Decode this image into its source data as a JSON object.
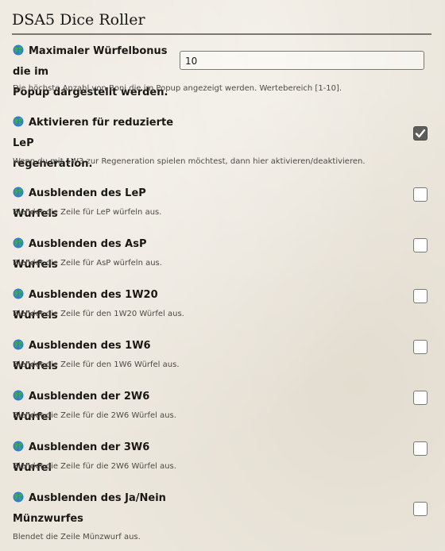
{
  "header": {
    "title": "DSA5 Dice Roller"
  },
  "icons": {
    "setting": "globe-icon"
  },
  "colors": {
    "checkbox_checked": "#5d5d5a",
    "divider": "#7a7971"
  },
  "settings": [
    {
      "label_line1": "Maximaler Würfelbonus die im",
      "label_line2": "Popup dargestellt werden.",
      "hint": "Die höchste Anzahl von Boni die im Popup angezeigt werden. Wertebereich [1-10].",
      "type": "number",
      "value": "10"
    },
    {
      "label_line1": "Aktivieren für reduzierte LeP",
      "label_line2": "regeneration.",
      "hint": "Wenn du mit 1W3 zur Regeneration spielen möchtest, dann hier aktivieren/deaktivieren.",
      "type": "checkbox",
      "checked": true
    },
    {
      "label_line1": "Ausblenden des LeP Würfels",
      "hint": "Blendet die Zeile für LeP würfeln aus.",
      "type": "checkbox",
      "checked": false
    },
    {
      "label_line1": "Ausblenden des AsP Würfels",
      "hint": "Blendet die Zeile für AsP würfeln aus.",
      "type": "checkbox",
      "checked": false
    },
    {
      "label_line1": "Ausblenden des 1W20 Würfels",
      "hint": "Blendet die Zeile für den 1W20 Würfel aus.",
      "type": "checkbox",
      "checked": false
    },
    {
      "label_line1": "Ausblenden des 1W6 Würfels",
      "hint": "Blendet die Zeile für den 1W6 Würfel aus.",
      "type": "checkbox",
      "checked": false
    },
    {
      "label_line1": "Ausblenden der 2W6 Würfel",
      "hint": "Blendet die Zeile für die 2W6 Würfel aus.",
      "type": "checkbox",
      "checked": false
    },
    {
      "label_line1": "Ausblenden der 3W6 Würfel",
      "hint": "Blendet die Zeile für die 2W6 Würfel aus.",
      "type": "checkbox",
      "checked": false
    },
    {
      "label_line1": "Ausblenden des Ja/Nein",
      "label_line2": "Münzwurfes",
      "hint": "Blendet die Zeile Münzwurf aus.",
      "type": "checkbox",
      "checked": false
    }
  ]
}
